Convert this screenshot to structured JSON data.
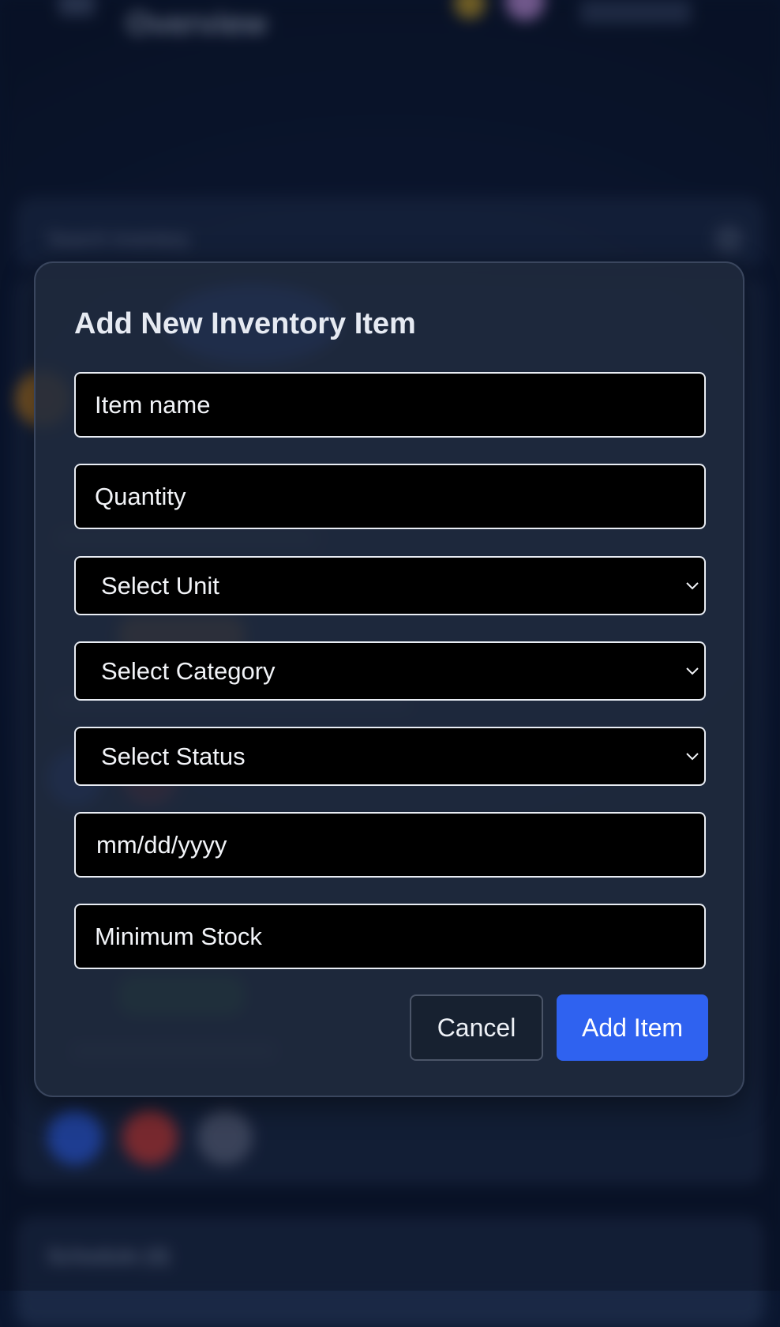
{
  "background": {
    "header_title": "Overview",
    "search_placeholder": "Search inventory",
    "section_title": "Schedule (4)"
  },
  "modal": {
    "title": "Add New Inventory Item",
    "fields": {
      "item_name": "Item name",
      "quantity": "Quantity",
      "unit": "Select Unit",
      "category": "Select Category",
      "status": "Select Status",
      "date": "mm/dd/yyyy",
      "minimum_stock": "Minimum Stock"
    },
    "buttons": {
      "cancel": "Cancel",
      "add": "Add Item"
    }
  },
  "colors": {
    "accent": "#2f62f0",
    "field_background": "#000000",
    "field_border": "#e9edf4",
    "modal_background": "#1f2a3c"
  }
}
